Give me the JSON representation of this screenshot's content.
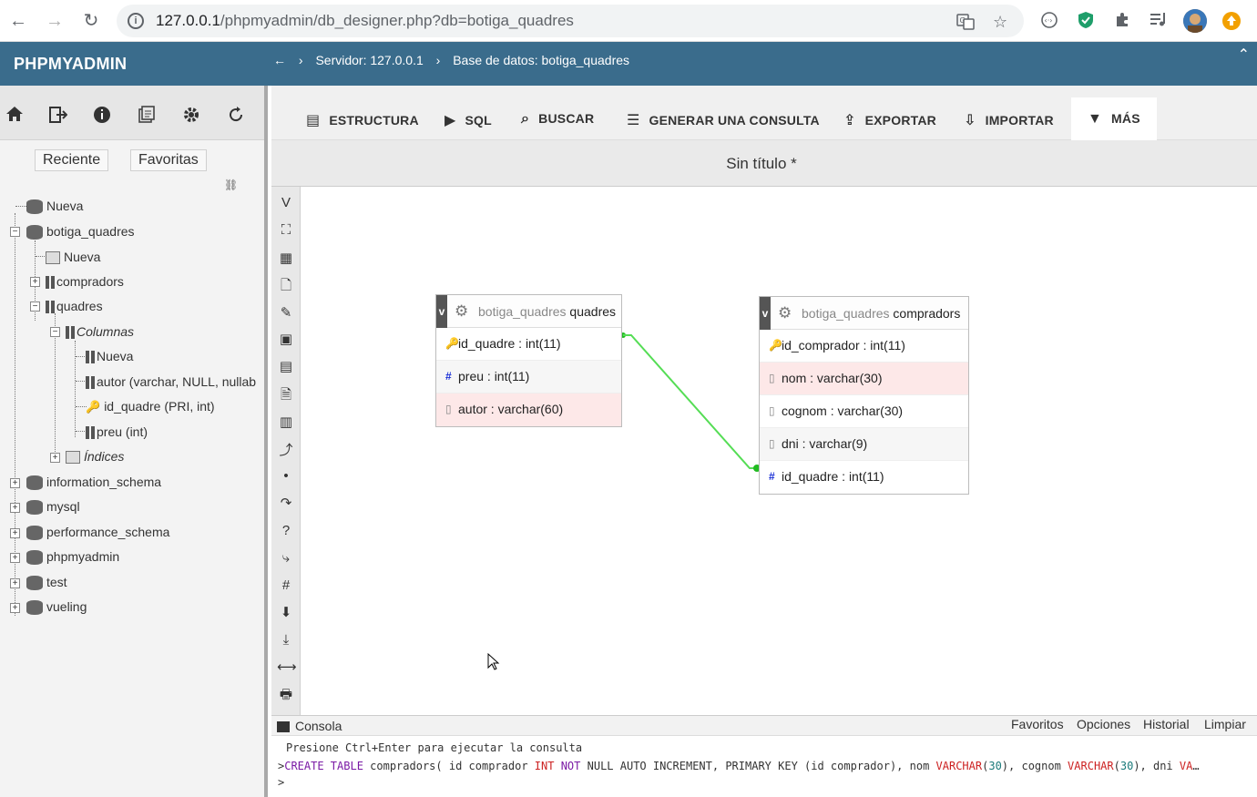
{
  "browser": {
    "url_host": "127.0.0.1",
    "url_path": "/phpmyadmin/db_designer.php?db=botiga_quadres"
  },
  "pma": {
    "logo": "PHPMYADMIN",
    "back_arrow": "←",
    "crumb_server": "Servidor: 127.0.0.1",
    "crumb_db": "Base de datos: botiga_quadres"
  },
  "left": {
    "tab_recent": "Reciente",
    "tab_fav": "Favoritas",
    "tree": {
      "nueva_root": "Nueva",
      "db_main": "botiga_quadres",
      "nueva_table": "Nueva",
      "t_compradors": "compradors",
      "t_quadres": "quadres",
      "columnas": "Columnas",
      "col_nueva": "Nueva",
      "col_autor": "autor (varchar, NULL, nullab",
      "col_id": "id_quadre (PRI, int)",
      "col_preu": "preu (int)",
      "indices": "Índices",
      "db_info": "information_schema",
      "db_mysql": "mysql",
      "db_perf": "performance_schema",
      "db_pma": "phpmyadmin",
      "db_test": "test",
      "db_vueling": "vueling"
    }
  },
  "menu": {
    "estructura": "ESTRUCTURA",
    "sql": "SQL",
    "buscar": "BUSCAR",
    "generar": "GENERAR UNA CONSULTA",
    "exportar": "EXPORTAR",
    "importar": "IMPORTAR",
    "mas": "MÁS"
  },
  "designer": {
    "title": "Sin título *",
    "t1": {
      "db": "botiga_quadres",
      "name": "quadres",
      "fields": [
        "id_quadre : int(11)",
        "preu : int(11)",
        "autor : varchar(60)"
      ]
    },
    "t2": {
      "db": "botiga_quadres",
      "name": "compradors",
      "fields": [
        "id_comprador : int(11)",
        "nom : varchar(30)",
        "cognom : varchar(30)",
        "dni : varchar(9)",
        "id_quadre : int(11)"
      ]
    }
  },
  "console": {
    "label": "Consola",
    "favoritos": "Favoritos",
    "opciones": "Opciones",
    "historial": "Historial",
    "limpiar": "Limpiar",
    "hint": "Presione Ctrl+Enter para ejecutar la consulta",
    "prompt": ">"
  }
}
